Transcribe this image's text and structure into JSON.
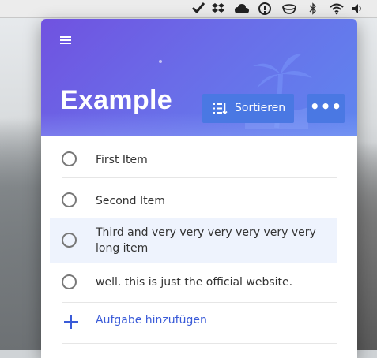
{
  "menubar": {
    "icons": [
      "checkmark-icon",
      "dropbox-icon",
      "cloud-icon",
      "info-icon",
      "coffee-cup-icon",
      "bluetooth-icon",
      "wifi-icon",
      "volume-icon"
    ]
  },
  "header": {
    "title": "Example",
    "sort_label": "Sortieren",
    "more_label": "•••"
  },
  "tasks": [
    {
      "text": "First Item",
      "selected": false
    },
    {
      "text": "Second Item",
      "selected": false
    },
    {
      "text": "Third and very very very very very very long item",
      "selected": true
    },
    {
      "text": "well. this is just the official website.",
      "selected": false
    }
  ],
  "add_task": {
    "label": "Aufgabe hinzufügen"
  },
  "colors": {
    "accent": "#4a78e3",
    "link": "#3a5bd8",
    "banner_start": "#7052e0",
    "banner_end": "#5f86ef"
  }
}
